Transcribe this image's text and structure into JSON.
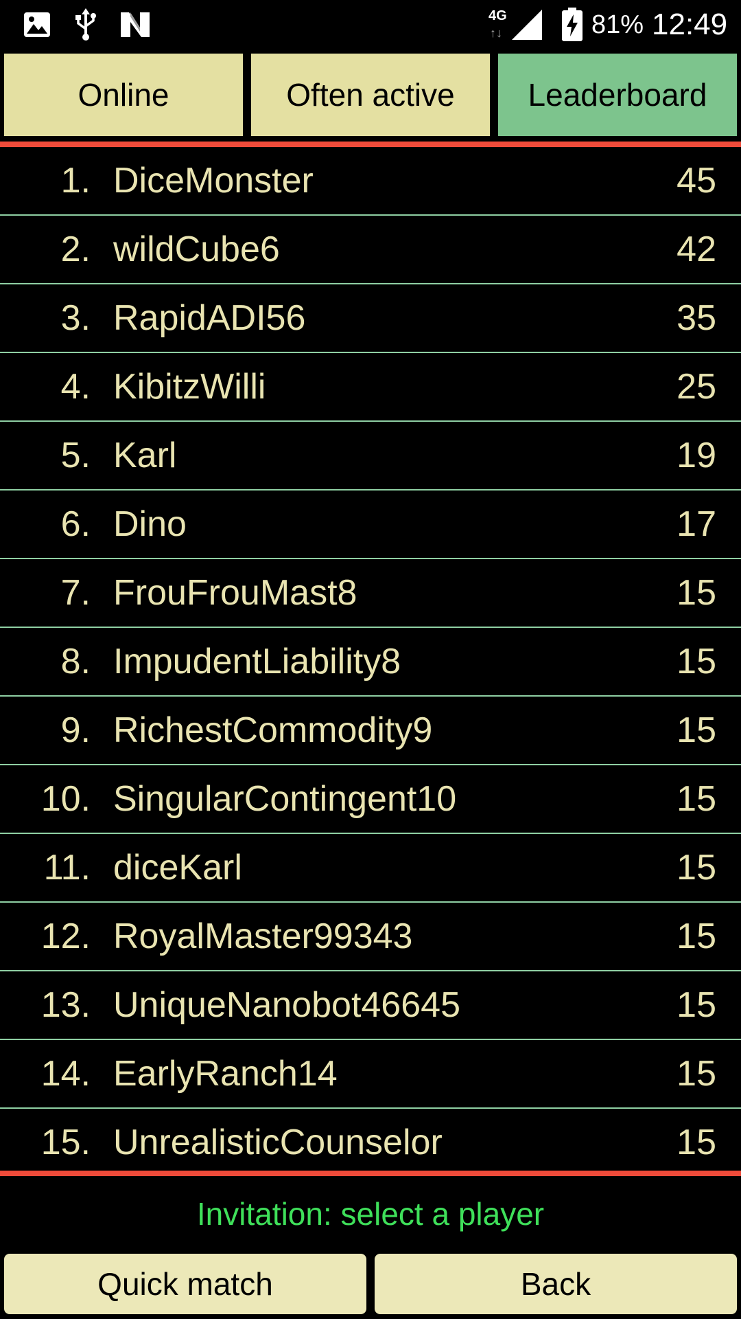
{
  "status_bar": {
    "network": "4G",
    "battery": "81%",
    "time": "12:49",
    "left_icons": [
      "image-icon",
      "usb-icon",
      "n-logo-icon"
    ],
    "right_icons": [
      "signal-icon",
      "battery-charging-icon"
    ]
  },
  "tabs": [
    {
      "label": "Online",
      "active": false
    },
    {
      "label": "Often active",
      "active": false
    },
    {
      "label": "Leaderboard",
      "active": true
    }
  ],
  "leaderboard": [
    {
      "rank": "1.",
      "name": "DiceMonster",
      "score": "45"
    },
    {
      "rank": "2.",
      "name": "wildCube6",
      "score": "42"
    },
    {
      "rank": "3.",
      "name": "RapidADI56",
      "score": "35"
    },
    {
      "rank": "4.",
      "name": "KibitzWilli",
      "score": "25"
    },
    {
      "rank": "5.",
      "name": "Karl",
      "score": "19"
    },
    {
      "rank": "6.",
      "name": "Dino",
      "score": "17"
    },
    {
      "rank": "7.",
      "name": "FrouFrouMast8",
      "score": "15"
    },
    {
      "rank": "8.",
      "name": "ImpudentLiability8",
      "score": "15"
    },
    {
      "rank": "9.",
      "name": "RichestCommodity9",
      "score": "15"
    },
    {
      "rank": "10.",
      "name": "SingularContingent10",
      "score": "15"
    },
    {
      "rank": "11.",
      "name": "diceKarl",
      "score": "15"
    },
    {
      "rank": "12.",
      "name": "RoyalMaster99343",
      "score": "15"
    },
    {
      "rank": "13.",
      "name": "UniqueNanobot46645",
      "score": "15"
    },
    {
      "rank": "14.",
      "name": "EarlyRanch14",
      "score": "15"
    },
    {
      "rank": "15.",
      "name": "UnrealisticCounselor",
      "score": "15"
    }
  ],
  "invitation": "Invitation: select a player",
  "buttons": {
    "quick_match": "Quick match",
    "back": "Back"
  },
  "colors": {
    "tab_inactive": "#e4e0a2",
    "tab_active": "#7dc48d",
    "divider_red": "#ef4b3a",
    "row_separator": "#8fcfa3",
    "row_text": "#e9e4b1",
    "invitation_text": "#3fe05a",
    "button_bg": "#ece8b8"
  }
}
